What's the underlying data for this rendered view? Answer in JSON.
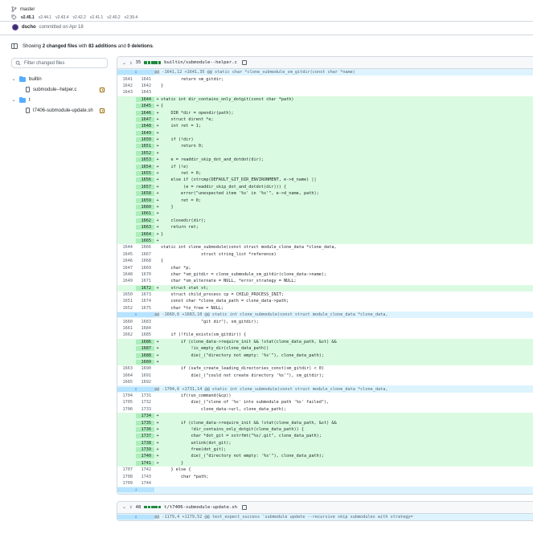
{
  "branch": {
    "name": "master"
  },
  "tags": [
    "v2.45.1",
    "v2.44.1",
    "v2.43.4",
    "v2.42.2",
    "v2.41.1",
    "v2.40.2",
    "v2.39.4"
  ],
  "commit": {
    "author": "dscho",
    "text": "committed on Apr 18"
  },
  "summary": {
    "prefix": "Showing",
    "files": "2 changed files",
    "middle": "with",
    "additions": "83 additions",
    "and": "and",
    "deletions": "0 deletions",
    "end": "."
  },
  "sidebar": {
    "filter_placeholder": "Filter changed files",
    "tree": [
      {
        "type": "dir",
        "label": "builtin"
      },
      {
        "type": "file",
        "label": "submodule--helper.c"
      },
      {
        "type": "dir",
        "label": "t"
      },
      {
        "type": "file",
        "label": "t7406-submodule-update.sh"
      }
    ]
  },
  "file1": {
    "count": "35",
    "path": "builtin/submodule--helper.c"
  },
  "file2": {
    "count": "48",
    "path": "t/t7406-submodule-update.sh",
    "hunk": "@@ -1179,4 +1179,52 @@ test_expect_success 'submodule update --recursive skip submodules with strategy="
  },
  "colors": {
    "addition_bg": "#dafbe1",
    "addition_num_bg": "#aceebb",
    "hunk_bg": "#ddf4ff",
    "accent": "#0969da",
    "diffstat": "#1f883d"
  },
  "lines": [
    {
      "t": "hunk",
      "c": "@@ -1641,12 +1641,35 @@ static char *clone_submodule_sm_gitdir(const char *name)"
    },
    {
      "t": "ctx",
      "a": "1641",
      "b": "1641",
      "c": "        return sm_gitdir;"
    },
    {
      "t": "ctx",
      "a": "1642",
      "b": "1642",
      "c": "}"
    },
    {
      "t": "ctx",
      "a": "1643",
      "b": "1643",
      "c": ""
    },
    {
      "t": "add",
      "b": "1644",
      "c": "static int dir_contains_only_dotgit(const char *path)"
    },
    {
      "t": "add",
      "b": "1645",
      "c": "{"
    },
    {
      "t": "add",
      "b": "1646",
      "c": "    DIR *dir = opendir(path);"
    },
    {
      "t": "add",
      "b": "1647",
      "c": "    struct dirent *e;"
    },
    {
      "t": "add",
      "b": "1648",
      "c": "    int ret = 1;"
    },
    {
      "t": "add",
      "b": "1649",
      "c": ""
    },
    {
      "t": "add",
      "b": "1650",
      "c": "    if (!dir)"
    },
    {
      "t": "add",
      "b": "1651",
      "c": "        return 0;"
    },
    {
      "t": "add",
      "b": "1652",
      "c": ""
    },
    {
      "t": "add",
      "b": "1653",
      "c": "    e = readdir_skip_dot_and_dotdot(dir);"
    },
    {
      "t": "add",
      "b": "1654",
      "c": "    if (!e)"
    },
    {
      "t": "add",
      "b": "1655",
      "c": "        ret = 0;"
    },
    {
      "t": "add",
      "b": "1656",
      "c": "    else if (strcmp(DEFAULT_GIT_DIR_ENVIRONMENT, e->d_name) ||"
    },
    {
      "t": "add",
      "b": "1657",
      "c": "         (e = readdir_skip_dot_and_dotdot(dir))) {"
    },
    {
      "t": "add",
      "b": "1658",
      "c": "        error(\"unexpected item '%s' in '%s'\", e->d_name, path);"
    },
    {
      "t": "add",
      "b": "1659",
      "c": "        ret = 0;"
    },
    {
      "t": "add",
      "b": "1660",
      "c": "    }"
    },
    {
      "t": "add",
      "b": "1661",
      "c": ""
    },
    {
      "t": "add",
      "b": "1662",
      "c": "    closedir(dir);"
    },
    {
      "t": "add",
      "b": "1663",
      "c": "    return ret;"
    },
    {
      "t": "add",
      "b": "1664",
      "c": "}"
    },
    {
      "t": "add",
      "b": "1665",
      "c": ""
    },
    {
      "t": "ctx",
      "a": "1644",
      "b": "1666",
      "c": "static int clone_submodule(const struct module_clone_data *clone_data,"
    },
    {
      "t": "ctx",
      "a": "1645",
      "b": "1667",
      "c": "                struct string_list *reference)"
    },
    {
      "t": "ctx",
      "a": "1646",
      "b": "1668",
      "c": "{"
    },
    {
      "t": "ctx",
      "a": "1647",
      "b": "1669",
      "c": "    char *p;"
    },
    {
      "t": "ctx",
      "a": "1648",
      "b": "1670",
      "c": "    char *sm_gitdir = clone_submodule_sm_gitdir(clone_data->name);"
    },
    {
      "t": "ctx",
      "a": "1649",
      "b": "1671",
      "c": "    char *sm_alternate = NULL, *error_strategy = NULL;"
    },
    {
      "t": "add",
      "b": "1672",
      "c": "    struct stat st;"
    },
    {
      "t": "ctx",
      "a": "1650",
      "b": "1673",
      "c": "    struct child_process cp = CHILD_PROCESS_INIT;"
    },
    {
      "t": "ctx",
      "a": "1651",
      "b": "1674",
      "c": "    const char *clone_data_path = clone_data->path;"
    },
    {
      "t": "ctx",
      "a": "1652",
      "b": "1675",
      "c": "    char *to_free = NULL;"
    },
    {
      "t": "hunk",
      "c": "@@ -1660,6 +1683,10 @@ static int clone_submodule(const struct module_clone_data *clone_data,"
    },
    {
      "t": "ctx",
      "a": "1660",
      "b": "1683",
      "c": "                \"git dir\"), sm_gitdir);"
    },
    {
      "t": "ctx",
      "a": "1661",
      "b": "1684",
      "c": ""
    },
    {
      "t": "ctx",
      "a": "1662",
      "b": "1685",
      "c": "    if (!file_exists(sm_gitdir)) {"
    },
    {
      "t": "add",
      "b": "1686",
      "c": "        if (clone_data->require_init && !stat(clone_data_path, &st) &&"
    },
    {
      "t": "add",
      "b": "1687",
      "c": "            !is_empty_dir(clone_data_path))"
    },
    {
      "t": "add",
      "b": "1688",
      "c": "            die(_(\"directory not empty: '%s'\"), clone_data_path);"
    },
    {
      "t": "add",
      "b": "1689",
      "c": ""
    },
    {
      "t": "ctx",
      "a": "1663",
      "b": "1690",
      "c": "        if (safe_create_leading_directories_const(sm_gitdir) < 0)"
    },
    {
      "t": "ctx",
      "a": "1664",
      "b": "1691",
      "c": "            die(_(\"could not create directory '%s'\"), sm_gitdir);"
    },
    {
      "t": "ctx",
      "a": "1665",
      "b": "1692",
      "c": ""
    },
    {
      "t": "hunk",
      "c": "@@ -1704,6 +1731,14 @@ static int clone_submodule(const struct module_clone_data *clone_data,"
    },
    {
      "t": "ctx",
      "a": "1704",
      "b": "1731",
      "c": "        if(run_command(&cp))"
    },
    {
      "t": "ctx",
      "a": "1705",
      "b": "1732",
      "c": "            die(_(\"clone of '%s' into submodule path '%s' failed\"),"
    },
    {
      "t": "ctx",
      "a": "1706",
      "b": "1733",
      "c": "                clone_data->url, clone_data_path);"
    },
    {
      "t": "add",
      "b": "1734",
      "c": ""
    },
    {
      "t": "add",
      "b": "1735",
      "c": "        if (clone_data->require_init && !stat(clone_data_path, &st) &&"
    },
    {
      "t": "add",
      "b": "1736",
      "c": "            !dir_contains_only_dotgit(clone_data_path)) {"
    },
    {
      "t": "add",
      "b": "1737",
      "c": "            char *dot_git = xstrfmt(\"%s/.git\", clone_data_path);"
    },
    {
      "t": "add",
      "b": "1738",
      "c": "            unlink(dot_git);"
    },
    {
      "t": "add",
      "b": "1739",
      "c": "            free(dot_git);"
    },
    {
      "t": "add",
      "b": "1740",
      "c": "            die(_(\"directory not empty: '%s'\"), clone_data_path);"
    },
    {
      "t": "add",
      "b": "1741",
      "c": "        }"
    },
    {
      "t": "ctx",
      "a": "1707",
      "b": "1742",
      "c": "    } else {"
    },
    {
      "t": "ctx",
      "a": "1708",
      "b": "1743",
      "c": "        char *path;"
    },
    {
      "t": "ctx",
      "a": "1709",
      "b": "1744",
      "c": ""
    },
    {
      "t": "expander",
      "c": ""
    }
  ]
}
